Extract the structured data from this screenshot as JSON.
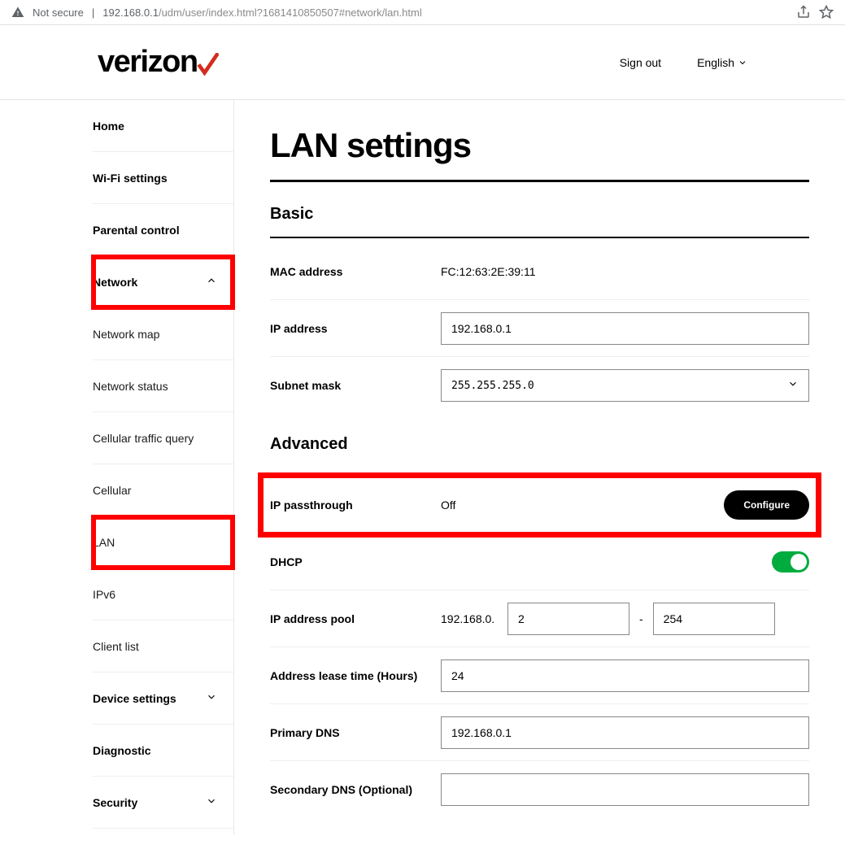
{
  "browser": {
    "security_text": "Not secure",
    "host": "192.168.0.1",
    "path": "/udm/user/index.html?1681410850507#network/lan.html"
  },
  "header": {
    "brand": "verizon",
    "signout": "Sign out",
    "language": "English"
  },
  "sidebar": {
    "home": "Home",
    "wifi": "Wi-Fi settings",
    "parental": "Parental control",
    "network": {
      "label": "Network",
      "items": {
        "map": "Network map",
        "status": "Network status",
        "ctq": "Cellular traffic query",
        "cellular": "Cellular",
        "lan": "LAN",
        "ipv6": "IPv6",
        "clientlist": "Client list"
      }
    },
    "device": "Device settings",
    "diag": "Diagnostic",
    "security": "Security"
  },
  "main": {
    "title": "LAN settings",
    "basic": {
      "title": "Basic",
      "mac_label": "MAC address",
      "mac_value": "FC:12:63:2E:39:11",
      "ip_label": "IP address",
      "ip_value": "192.168.0.1",
      "subnet_label": "Subnet mask",
      "subnet_value": "255.255.255.0"
    },
    "advanced": {
      "title": "Advanced",
      "passthrough_label": "IP passthrough",
      "passthrough_value": "Off",
      "configure": "Configure",
      "dhcp_label": "DHCP",
      "pool_label": "IP address pool",
      "pool_prefix": "192.168.0.",
      "pool_start": "2",
      "pool_dash": "-",
      "pool_end": "254",
      "lease_label": "Address lease time (Hours)",
      "lease_value": "24",
      "pdns_label": "Primary DNS",
      "pdns_value": "192.168.0.1",
      "sdns_label": "Secondary DNS (Optional)",
      "sdns_value": ""
    }
  }
}
